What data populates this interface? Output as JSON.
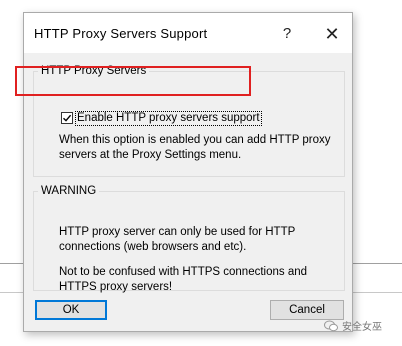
{
  "dialog": {
    "title": "HTTP Proxy Servers Support",
    "help_symbol": "?",
    "close_symbol": "✕"
  },
  "group1": {
    "legend": "HTTP Proxy Servers",
    "checkbox_label": "Enable HTTP proxy servers support",
    "checked": true,
    "description": "When this option is enabled you can add HTTP proxy servers at the Proxy Settings menu."
  },
  "group2": {
    "legend": "WARNING",
    "text1": "HTTP proxy server can only be used for HTTP connections (web browsers and etc).",
    "text2": "Not to be confused with HTTPS connections and HTTPS proxy servers!"
  },
  "buttons": {
    "ok": "OK",
    "cancel": "Cancel"
  },
  "watermark": {
    "text": "安全女巫"
  },
  "colors": {
    "highlight": "#e02020",
    "focus": "#0078d7"
  }
}
